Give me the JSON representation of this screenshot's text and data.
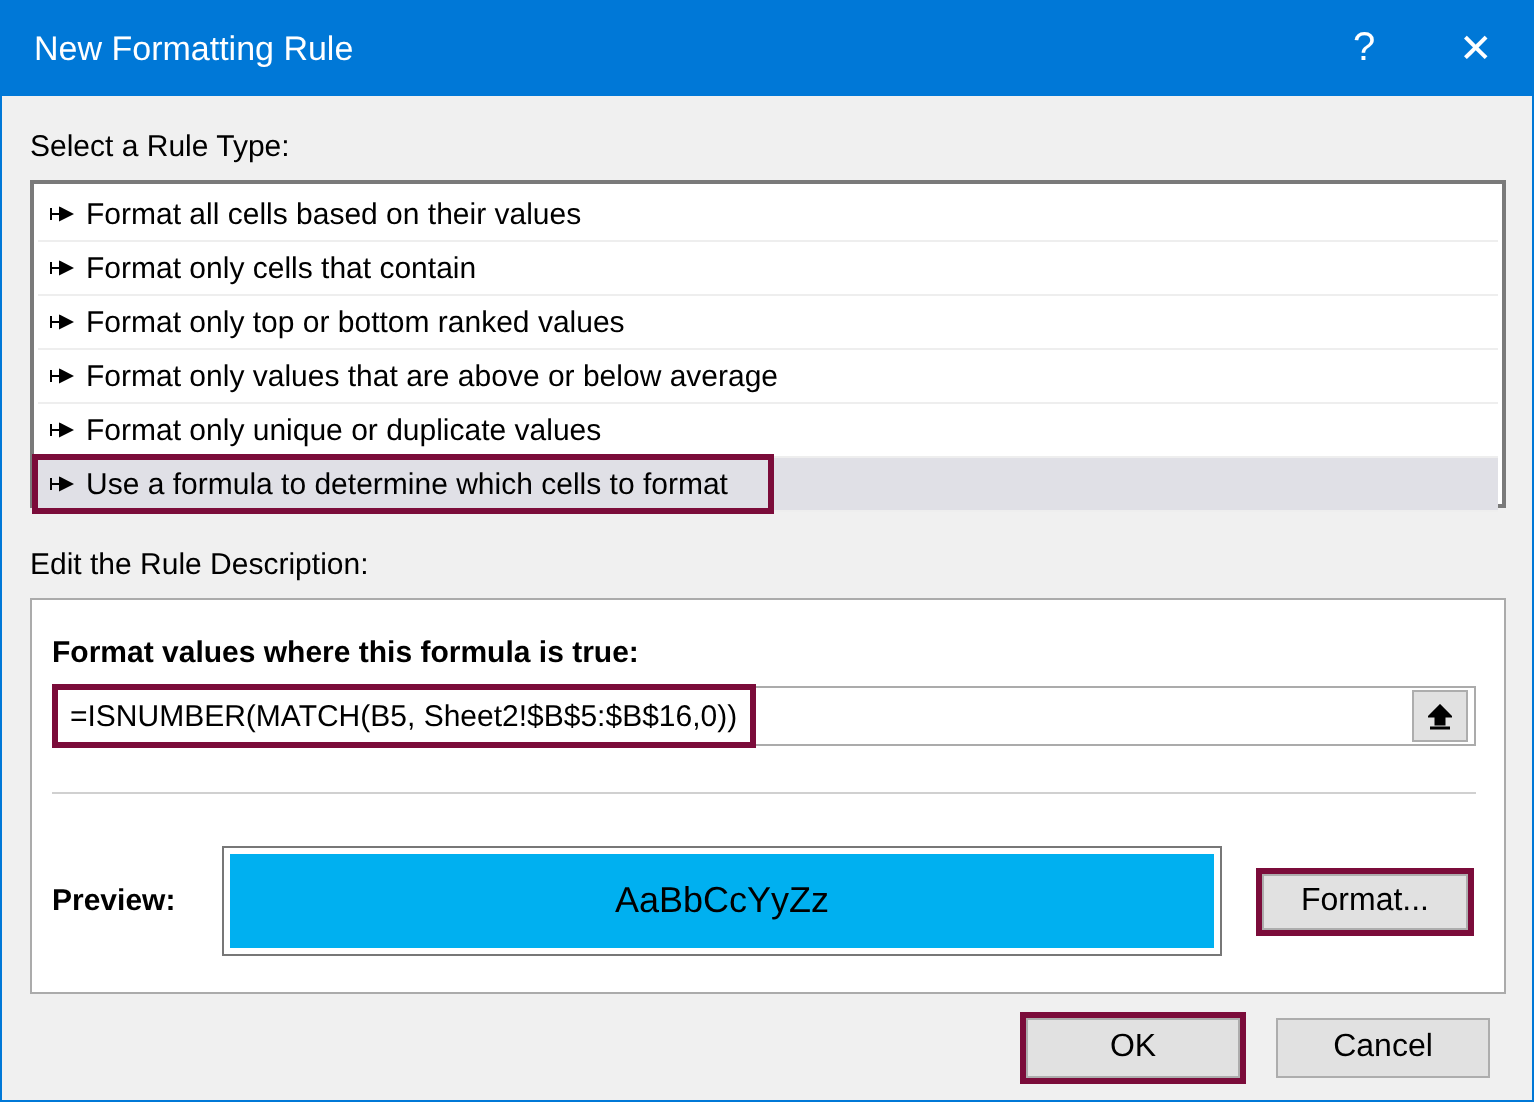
{
  "window": {
    "title": "New Formatting Rule",
    "help": "?",
    "close": "✕"
  },
  "rule_type_label": "Select a Rule Type:",
  "rule_types": [
    {
      "label": "Format all cells based on their values",
      "selected": false,
      "highlighted": false
    },
    {
      "label": "Format only cells that contain",
      "selected": false,
      "highlighted": false
    },
    {
      "label": "Format only top or bottom ranked values",
      "selected": false,
      "highlighted": false
    },
    {
      "label": "Format only values that are above or below average",
      "selected": false,
      "highlighted": false
    },
    {
      "label": "Format only unique or duplicate values",
      "selected": false,
      "highlighted": false
    },
    {
      "label": "Use a formula to determine which cells to format",
      "selected": true,
      "highlighted": true
    }
  ],
  "description_label": "Edit the Rule Description:",
  "formula_label": "Format values where this formula is true:",
  "formula": {
    "value": "=ISNUMBER(MATCH(B5, Sheet2!$B$5:$B$16,0))",
    "highlighted": true
  },
  "preview": {
    "label": "Preview:",
    "sample": "AaBbCcYyZz",
    "color": "#00b0f0"
  },
  "format_button": {
    "label": "Format...",
    "highlighted": true
  },
  "buttons": [
    {
      "label": "OK",
      "highlighted": true
    },
    {
      "label": "Cancel",
      "highlighted": false
    }
  ]
}
